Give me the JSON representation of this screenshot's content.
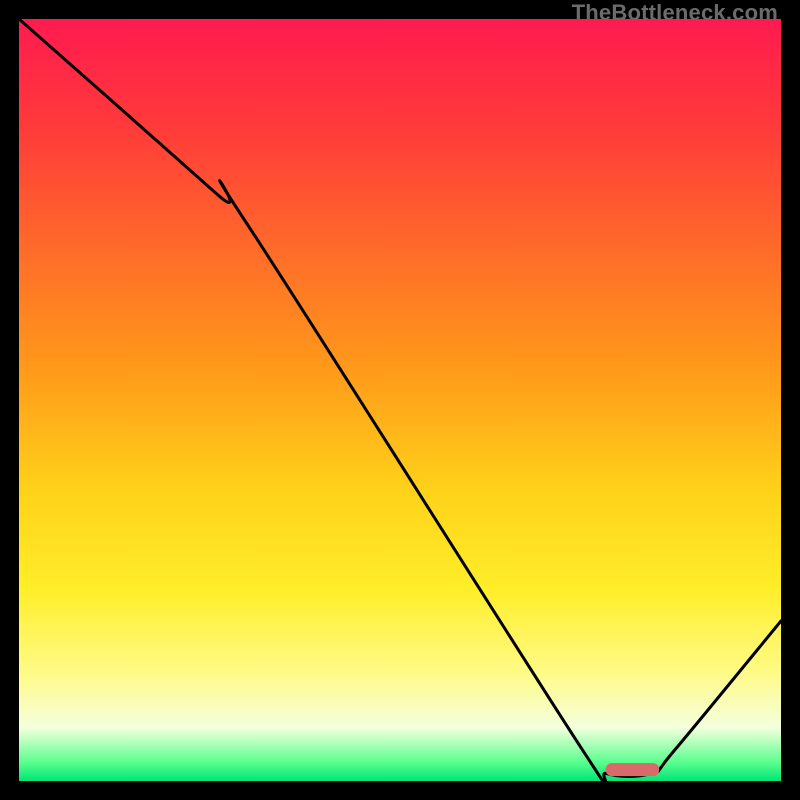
{
  "watermark": "TheBottleneck.com",
  "chart_data": {
    "type": "line",
    "title": "",
    "xlabel": "",
    "ylabel": "",
    "xlim": [
      0,
      100
    ],
    "ylim": [
      0,
      100
    ],
    "grid": false,
    "curve": [
      {
        "x": 0,
        "y": 100
      },
      {
        "x": 26,
        "y": 77
      },
      {
        "x": 30,
        "y": 73
      },
      {
        "x": 74,
        "y": 4
      },
      {
        "x": 77,
        "y": 1
      },
      {
        "x": 83,
        "y": 1
      },
      {
        "x": 86,
        "y": 4
      },
      {
        "x": 100,
        "y": 21
      }
    ],
    "marker": {
      "x_start": 77,
      "x_end": 84,
      "y": 1.5,
      "color": "#d96a6a"
    },
    "gradient_stops": [
      {
        "offset": 0.0,
        "color": "#ff1a4f"
      },
      {
        "offset": 0.14,
        "color": "#ff3a3a"
      },
      {
        "offset": 0.3,
        "color": "#ff6a2a"
      },
      {
        "offset": 0.46,
        "color": "#ff9a1a"
      },
      {
        "offset": 0.62,
        "color": "#ffd21a"
      },
      {
        "offset": 0.75,
        "color": "#ffee2a"
      },
      {
        "offset": 0.86,
        "color": "#fffb89"
      },
      {
        "offset": 0.93,
        "color": "#f4ffdd"
      },
      {
        "offset": 0.975,
        "color": "#5cff8f"
      },
      {
        "offset": 1.0,
        "color": "#00e676"
      }
    ],
    "axis_color": "#000000",
    "axis_width": 19
  }
}
